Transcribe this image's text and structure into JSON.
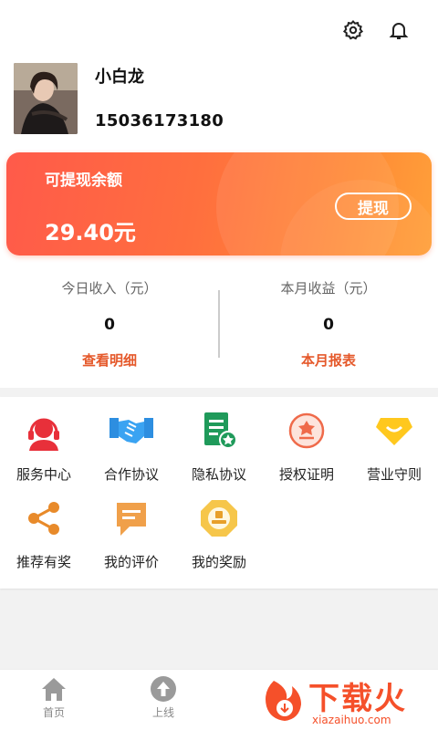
{
  "header": {
    "settings_icon": "gear-icon",
    "notification_icon": "bell-icon"
  },
  "profile": {
    "name": "小白龙",
    "phone": "15036173180"
  },
  "balance": {
    "label": "可提现余额",
    "amount": "29.40元",
    "withdraw_label": "提现"
  },
  "stats": [
    {
      "label": "今日收入（元）",
      "value": "0",
      "link": "查看明细"
    },
    {
      "label": "本月收益（元）",
      "value": "0",
      "link": "本月报表"
    }
  ],
  "services": [
    {
      "label": "服务中心",
      "icon": "headset-icon"
    },
    {
      "label": "合作协议",
      "icon": "handshake-icon"
    },
    {
      "label": "隐私协议",
      "icon": "document-star-icon"
    },
    {
      "label": "授权证明",
      "icon": "certificate-icon"
    },
    {
      "label": "营业守则",
      "icon": "gem-icon"
    },
    {
      "label": "推荐有奖",
      "icon": "share-icon"
    },
    {
      "label": "我的评价",
      "icon": "comment-icon"
    },
    {
      "label": "我的奖励",
      "icon": "award-icon"
    }
  ],
  "tabbar": [
    {
      "label": "首页",
      "icon": "home-icon"
    },
    {
      "label": "上线",
      "icon": "upload-arrow-icon"
    }
  ],
  "watermark": {
    "title": "下载火",
    "url": "xiazaihuo.com"
  },
  "colors": {
    "accent": "#e5592b",
    "card_start": "#ff5a4a",
    "card_end": "#ffa03a"
  }
}
